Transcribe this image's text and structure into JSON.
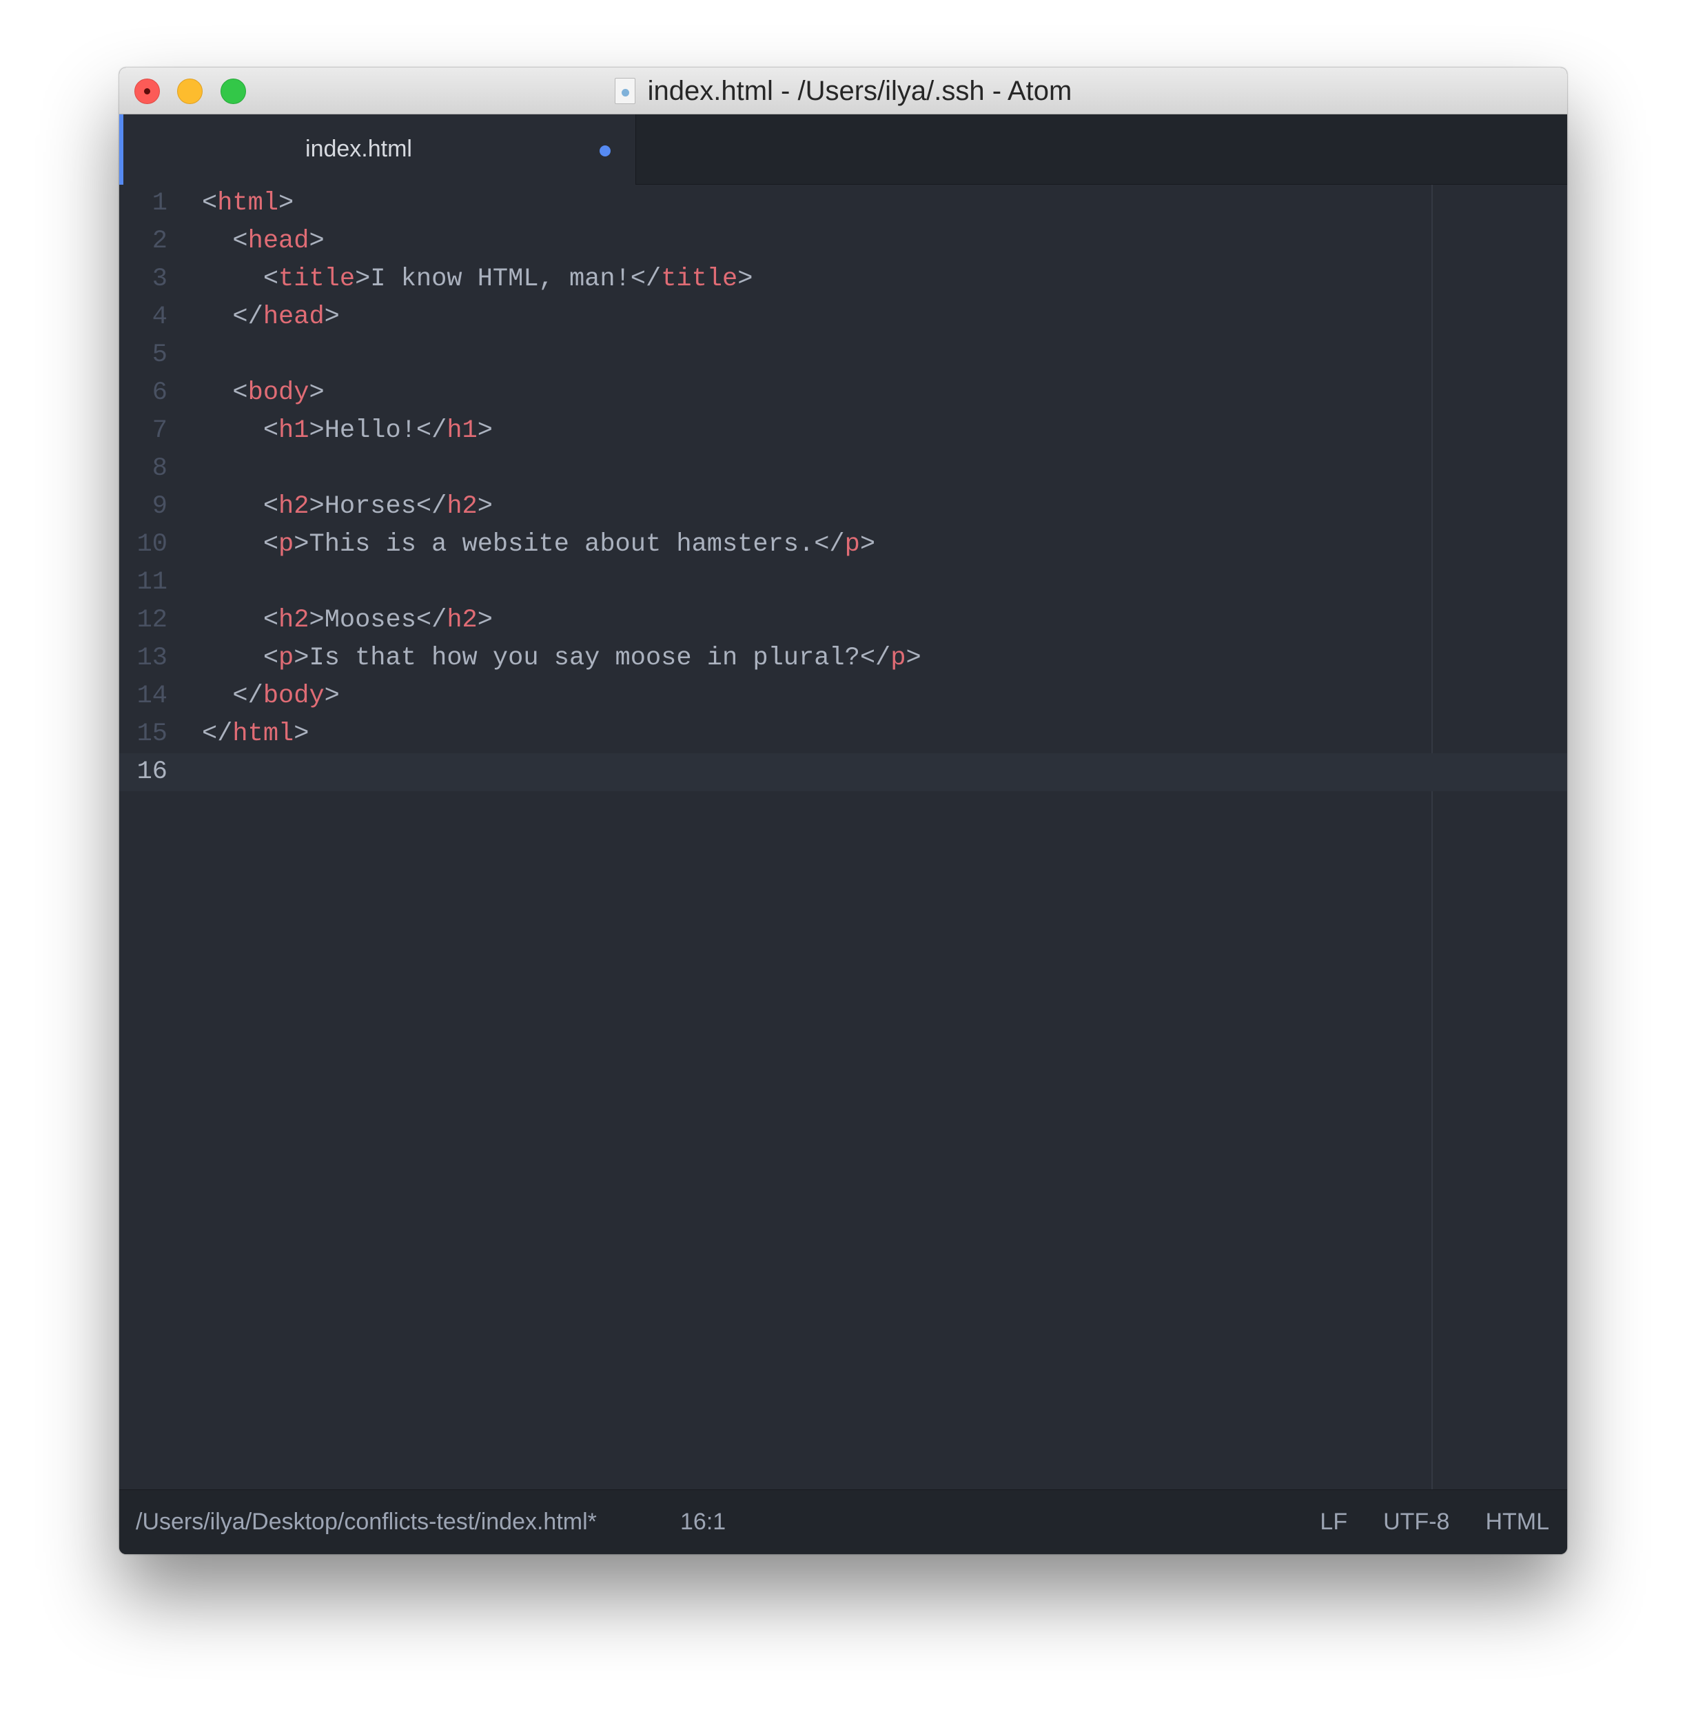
{
  "window": {
    "title": "index.html - /Users/ilya/.ssh - Atom",
    "title_icon": "document-icon"
  },
  "tabs": [
    {
      "label": "index.html",
      "modified": true
    }
  ],
  "editor": {
    "lines": [
      {
        "number": "1",
        "indent": "",
        "tokens": [
          [
            "punc",
            "<"
          ],
          [
            "tag",
            "html"
          ],
          [
            "punc",
            ">"
          ]
        ]
      },
      {
        "number": "2",
        "indent": "  ",
        "tokens": [
          [
            "punc",
            "<"
          ],
          [
            "tag",
            "head"
          ],
          [
            "punc",
            ">"
          ]
        ]
      },
      {
        "number": "3",
        "indent": "    ",
        "tokens": [
          [
            "punc",
            "<"
          ],
          [
            "tag",
            "title"
          ],
          [
            "punc",
            ">"
          ],
          [
            "text",
            "I know HTML, man!"
          ],
          [
            "punc",
            "</"
          ],
          [
            "tag",
            "title"
          ],
          [
            "punc",
            ">"
          ]
        ]
      },
      {
        "number": "4",
        "indent": "  ",
        "tokens": [
          [
            "punc",
            "</"
          ],
          [
            "tag",
            "head"
          ],
          [
            "punc",
            ">"
          ]
        ]
      },
      {
        "number": "5",
        "indent": "",
        "tokens": []
      },
      {
        "number": "6",
        "indent": "  ",
        "tokens": [
          [
            "punc",
            "<"
          ],
          [
            "tag",
            "body"
          ],
          [
            "punc",
            ">"
          ]
        ]
      },
      {
        "number": "7",
        "indent": "    ",
        "tokens": [
          [
            "punc",
            "<"
          ],
          [
            "tag",
            "h1"
          ],
          [
            "punc",
            ">"
          ],
          [
            "text",
            "Hello!"
          ],
          [
            "punc",
            "</"
          ],
          [
            "tag",
            "h1"
          ],
          [
            "punc",
            ">"
          ]
        ]
      },
      {
        "number": "8",
        "indent": "",
        "tokens": []
      },
      {
        "number": "9",
        "indent": "    ",
        "tokens": [
          [
            "punc",
            "<"
          ],
          [
            "tag",
            "h2"
          ],
          [
            "punc",
            ">"
          ],
          [
            "text",
            "Horses"
          ],
          [
            "punc",
            "</"
          ],
          [
            "tag",
            "h2"
          ],
          [
            "punc",
            ">"
          ]
        ]
      },
      {
        "number": "10",
        "indent": "    ",
        "tokens": [
          [
            "punc",
            "<"
          ],
          [
            "tag",
            "p"
          ],
          [
            "punc",
            ">"
          ],
          [
            "text",
            "This is a website about hamsters."
          ],
          [
            "punc",
            "</"
          ],
          [
            "tag",
            "p"
          ],
          [
            "punc",
            ">"
          ]
        ]
      },
      {
        "number": "11",
        "indent": "",
        "tokens": []
      },
      {
        "number": "12",
        "indent": "    ",
        "tokens": [
          [
            "punc",
            "<"
          ],
          [
            "tag",
            "h2"
          ],
          [
            "punc",
            ">"
          ],
          [
            "text",
            "Mooses"
          ],
          [
            "punc",
            "</"
          ],
          [
            "tag",
            "h2"
          ],
          [
            "punc",
            ">"
          ]
        ]
      },
      {
        "number": "13",
        "indent": "    ",
        "tokens": [
          [
            "punc",
            "<"
          ],
          [
            "tag",
            "p"
          ],
          [
            "punc",
            ">"
          ],
          [
            "text",
            "Is that how you say moose in plural?"
          ],
          [
            "punc",
            "</"
          ],
          [
            "tag",
            "p"
          ],
          [
            "punc",
            ">"
          ]
        ]
      },
      {
        "number": "14",
        "indent": "  ",
        "tokens": [
          [
            "punc",
            "</"
          ],
          [
            "tag",
            "body"
          ],
          [
            "punc",
            ">"
          ]
        ]
      },
      {
        "number": "15",
        "indent": "",
        "tokens": [
          [
            "punc",
            "</"
          ],
          [
            "tag",
            "html"
          ],
          [
            "punc",
            ">"
          ]
        ]
      },
      {
        "number": "16",
        "indent": "",
        "tokens": [],
        "cursor": true
      }
    ]
  },
  "status_bar": {
    "file_path": "/Users/ilya/Desktop/conflicts-test/index.html*",
    "cursor_position": "16:1",
    "line_ending": "LF",
    "encoding": "UTF-8",
    "grammar": "HTML"
  },
  "colors": {
    "editor_background": "#282c34",
    "tag": "#e06c75",
    "text": "#abb2bf",
    "accent": "#568af2"
  }
}
